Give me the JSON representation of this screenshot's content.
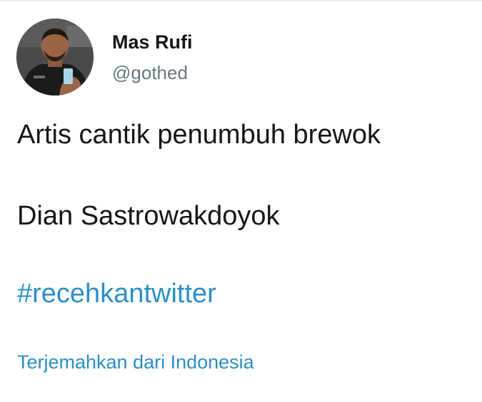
{
  "author": {
    "name": "Mas Rufi",
    "handle": "@gothed"
  },
  "tweet": {
    "line1": "Artis cantik penumbuh brewok",
    "line2": "Dian Sastrowakdoyok",
    "hashtag": "#recehkantwitter"
  },
  "translate_link": "Terjemahkan dari Indonesia",
  "colors": {
    "text": "#14171a",
    "secondary": "#657786",
    "link": "#2b8fc6"
  }
}
